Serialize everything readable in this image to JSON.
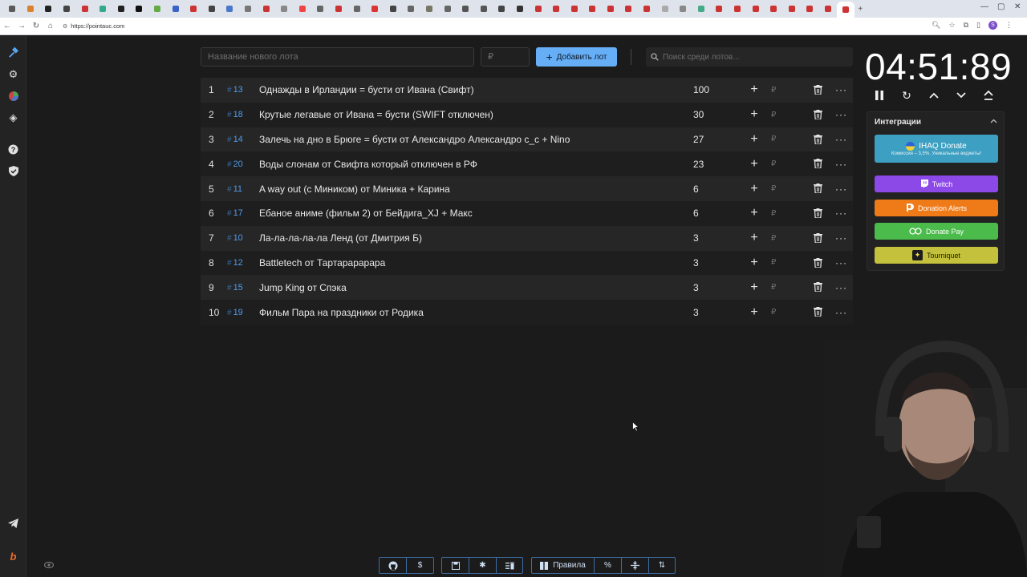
{
  "browser": {
    "url": "https://pointauc.com",
    "profile_initial": "S",
    "new_tab": "+"
  },
  "rail": {
    "icons": [
      "gavel-icon",
      "settings-gear-icon",
      "wheel-icon",
      "layers-icon",
      "help-icon",
      "shield-icon",
      "telegram-icon",
      "boosty-icon"
    ]
  },
  "new_lot": {
    "name_placeholder": "Название нового лота",
    "amount_placeholder": "₽",
    "add_button_label": "Добавить лот"
  },
  "search": {
    "placeholder": "Поиск среди лотов..."
  },
  "lots": [
    {
      "num": "1",
      "id": "13",
      "name": "Однажды в Ирландии = бусти от Ивана (Свифт)",
      "amount": "100"
    },
    {
      "num": "2",
      "id": "18",
      "name": "Крутые легавые от Ивана = бусти (SWIFT отключен)",
      "amount": "30"
    },
    {
      "num": "3",
      "id": "14",
      "name": "Залечь на дно в Брюге  = бусти от Александро Александро с_с + Nino",
      "amount": "27"
    },
    {
      "num": "4",
      "id": "20",
      "name": "Воды слонам от Свифта который отключен в РФ",
      "amount": "23"
    },
    {
      "num": "5",
      "id": "11",
      "name": "A way out (с Миником) от Миника + Карина",
      "amount": "6"
    },
    {
      "num": "6",
      "id": "17",
      "name": "Ебаное аниме (фильм 2) от Бейдига_XJ + Макс",
      "amount": "6"
    },
    {
      "num": "7",
      "id": "10",
      "name": "Ла-ла-ла-ла-ла Ленд (от Дмитрия Б)",
      "amount": "3"
    },
    {
      "num": "8",
      "id": "12",
      "name": "Battletech от Тартарарарара",
      "amount": "3"
    },
    {
      "num": "9",
      "id": "15",
      "name": "Jump King от Спэка",
      "amount": "3"
    },
    {
      "num": "10",
      "id": "19",
      "name": "Фильм Пара на праздники от Родика",
      "amount": "3"
    }
  ],
  "lot_row": {
    "hash": "#",
    "plus": "+",
    "currency": "₽",
    "more": "···"
  },
  "timer": {
    "value": "04:51:89"
  },
  "integrations": {
    "title": "Интеграции",
    "ihaq_label": "IHAQ Donate",
    "ihaq_subtitle": "Комиссия – 3,5%. Уникальные виджеты!",
    "twitch_label": "Twitch",
    "donation_alerts_label": "Donation Alerts",
    "donate_pay_label": "Donate Pay",
    "tourniquet_label": "Tourniquet"
  },
  "bottom_toolbar": {
    "rules_label": "Правила",
    "percent_label": "%"
  },
  "colors": {
    "accent": "#66aef5",
    "twitch": "#8d48e8",
    "donation_alerts": "#ee7a18",
    "donate_pay": "#4bbb4b",
    "tourniquet": "#c4c23c",
    "ihaq": "#3d9fc1"
  }
}
